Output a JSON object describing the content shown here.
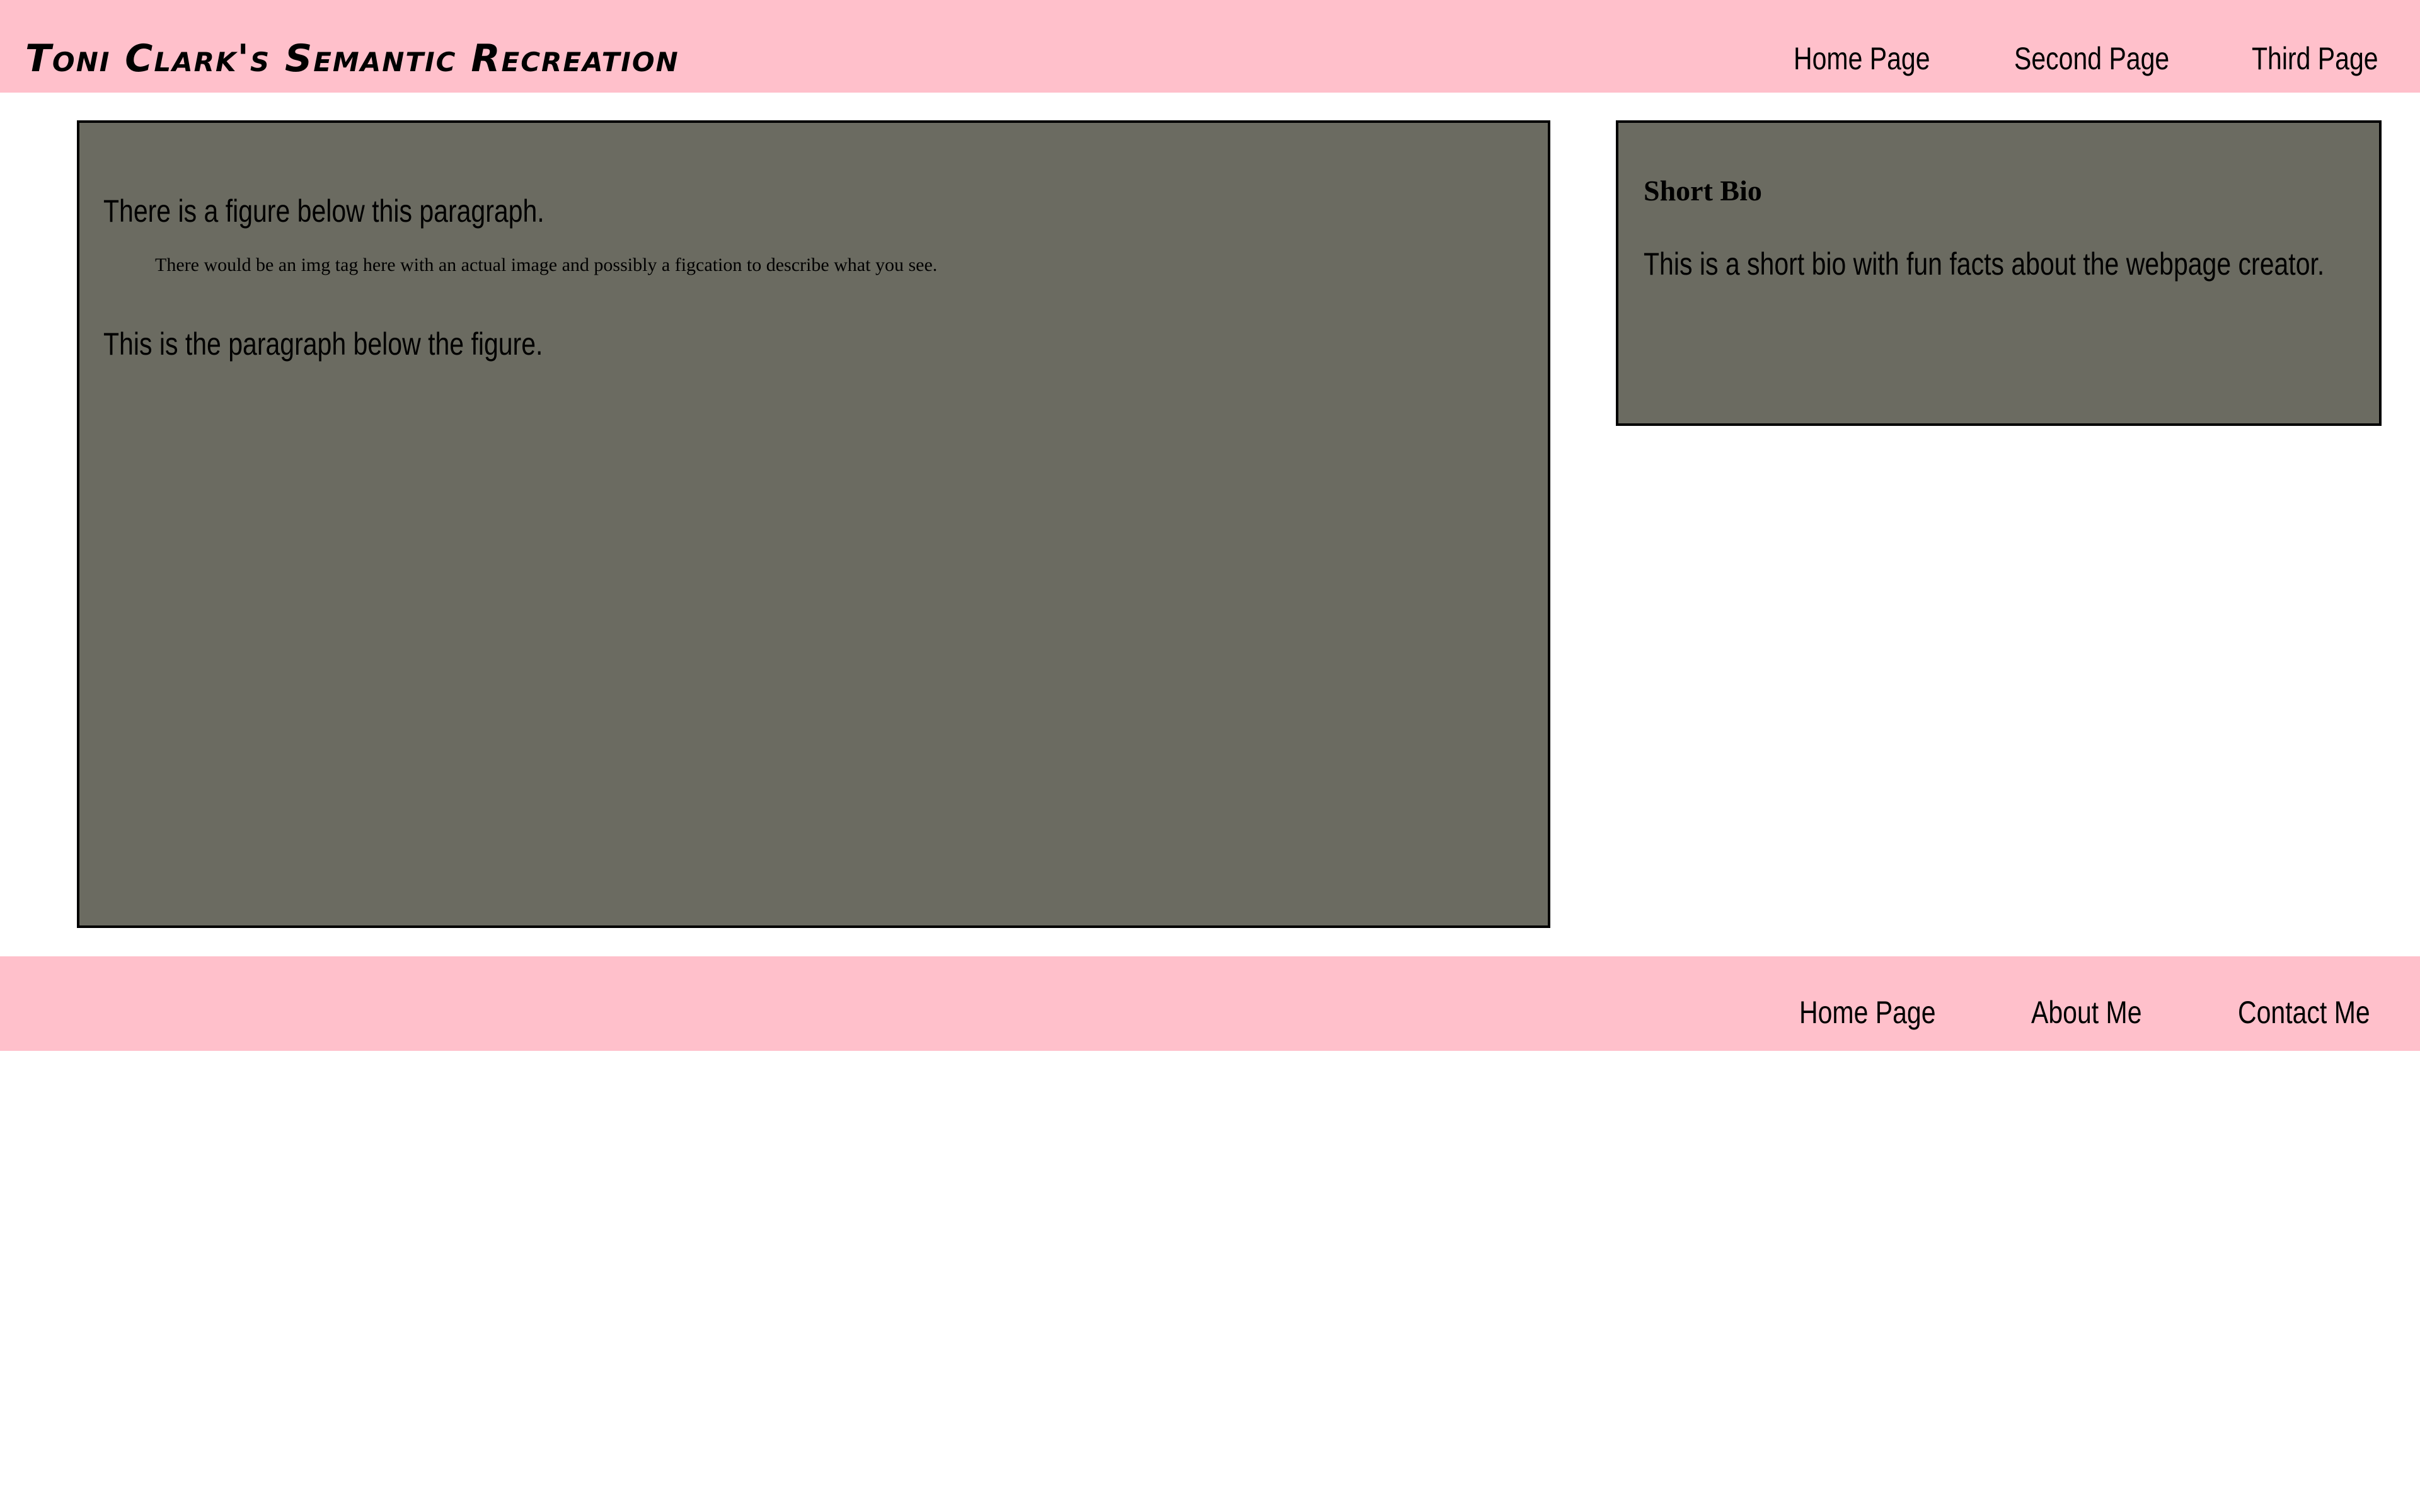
{
  "header": {
    "title": "Toni Clark's Semantic Recreation",
    "nav": [
      {
        "label": "Home Page"
      },
      {
        "label": "Second Page"
      },
      {
        "label": "Third Page"
      }
    ]
  },
  "main": {
    "paragraph_above": "There is a figure below this paragraph.",
    "figure_note": "There would be an img tag here with an actual image and possibly a figcation to describe what you see.",
    "paragraph_below": "This is the paragraph below the figure."
  },
  "aside": {
    "heading": "Short Bio",
    "text": "This is a short bio with fun facts about the webpage creator."
  },
  "footer": {
    "nav": [
      {
        "label": "Home Page"
      },
      {
        "label": "About Me"
      },
      {
        "label": "Contact Me"
      }
    ]
  },
  "colors": {
    "bar_background": "#ffc0cb",
    "panel_background": "#6b6b61",
    "panel_border": "#000000",
    "text": "#000000"
  }
}
